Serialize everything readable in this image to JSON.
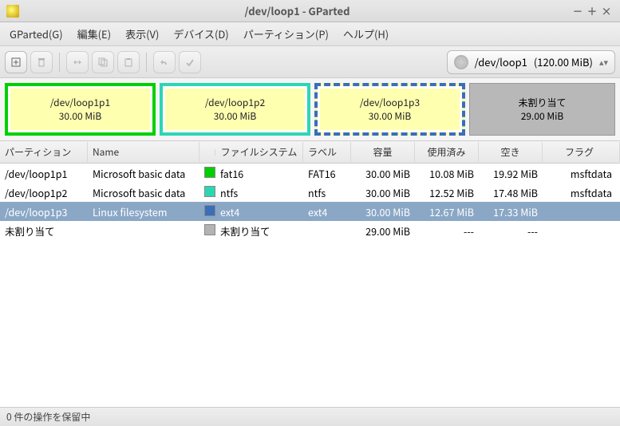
{
  "window": {
    "title": "/dev/loop1 - GParted"
  },
  "menu": [
    {
      "label": "GParted(G)"
    },
    {
      "label": "編集(E)"
    },
    {
      "label": "表示(V)"
    },
    {
      "label": "デバイス(D)"
    },
    {
      "label": "パーティション(P)"
    },
    {
      "label": "ヘルプ(H)"
    }
  ],
  "device_selector": {
    "device": "/dev/loop1",
    "size": "(120.00 MiB)"
  },
  "map": [
    {
      "name": "/dev/loop1p1",
      "size": "30.00 MiB",
      "cls": "mb1"
    },
    {
      "name": "/dev/loop1p2",
      "size": "30.00 MiB",
      "cls": "mb2"
    },
    {
      "name": "/dev/loop1p3",
      "size": "30.00 MiB",
      "cls": "mb3"
    },
    {
      "name": "未割り当て",
      "size": "29.00 MiB",
      "cls": "mb4"
    }
  ],
  "columns": {
    "part": "パーティション",
    "name": "Name",
    "fs": "ファイルシステム",
    "label": "ラベル",
    "size": "容量",
    "used": "使用済み",
    "free": "空き",
    "flags": "フラグ"
  },
  "rows": [
    {
      "part": "/dev/loop1p1",
      "name": "Microsoft basic data",
      "color": "#00d000",
      "fs": "fat16",
      "label": "FAT16",
      "size": "30.00 MiB",
      "used": "10.08 MiB",
      "free": "19.92 MiB",
      "flags": "msftdata",
      "sel": false
    },
    {
      "part": "/dev/loop1p2",
      "name": "Microsoft basic data",
      "color": "#2dd6b3",
      "fs": "ntfs",
      "label": "ntfs",
      "size": "30.00 MiB",
      "used": "12.52 MiB",
      "free": "17.48 MiB",
      "flags": "msftdata",
      "sel": false
    },
    {
      "part": "/dev/loop1p3",
      "name": "Linux filesystem",
      "color": "#3a6eb8",
      "fs": "ext4",
      "label": "ext4",
      "size": "30.00 MiB",
      "used": "12.67 MiB",
      "free": "17.33 MiB",
      "flags": "",
      "sel": true
    },
    {
      "part": "未割り当て",
      "name": "",
      "color": "#b3b3b3",
      "fs": "未割り当て",
      "label": "",
      "size": "29.00 MiB",
      "used": "---",
      "free": "---",
      "flags": "",
      "sel": false
    }
  ],
  "status": "0 件の操作を保留中"
}
